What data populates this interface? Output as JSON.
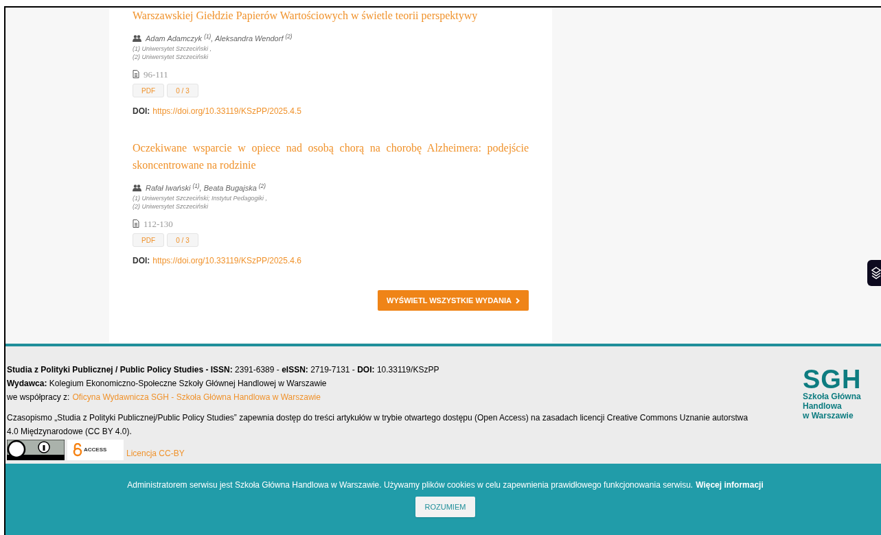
{
  "articles": [
    {
      "title": "Warszawskiej Giełdzie Papierów Wartościowych w świetle teorii perspektywy",
      "authors": "Adam Adamczyk $^{(1)}$, Aleksandra Wendorf $^{(2)}$",
      "affiliations": [
        "(1) Uniwersytet Szczeciński ,",
        "(2) Uniwersytet Szczeciński"
      ],
      "pages": "96-111",
      "buttons": [
        "PDF",
        "0 / 3"
      ],
      "doi_label": "DOI:",
      "doi": "https://doi.org/10.33119/KSzPP/2025.4.5"
    },
    {
      "title": "Oczekiwane wsparcie w opiece nad osobą chorą na chorobę Alzheimera: podejście skoncentrowane na rodzinie",
      "authors": "Rafał Iwański $^{(1)}$, Beata Bugajska $^{(2)}$",
      "affiliations": [
        "(1) Uniwersytet Szczeciński; Instytut Pedagogiki ,",
        "(2) Uniwersytet Szczeciński"
      ],
      "pages": "112-130",
      "buttons": [
        "PDF",
        "0 / 3"
      ],
      "doi_label": "DOI:",
      "doi": "https://doi.org/10.33119/KSzPP/2025.4.6"
    }
  ],
  "all_issues_button": "WYŚWIETL WSZYSTKIE WYDANIA",
  "footer": {
    "journal": "**Studia z Polityki Publicznej / Public Policy Studies - ISSN:** 2391-6389 - **eISSN:** 2719-7131 - **DOI:** 10.33119/KSzPP",
    "publisher": "**Wydawca:** Kolegium Ekonomiczno-Społeczne Szkoły Głównej Handlowej w Warszawie",
    "cooperation_label": "we współpracy z:",
    "cooperation_link": "Oficyna Wydawnicza SGH - Szkoła Główna Handlowa w Warszawie",
    "license_text": "Czasopismo „Studia z Polityki Publicznej/Public Policy Studies” zapewnia dostęp do treści artykułów w trybie otwartego dostępu (Open Access) na zasadach licencji Creative Commons Uznanie autorstwa 4.0 Międzynarodowe (CC BY 4.0).",
    "open_access": "ACCESS",
    "license_link": "Licencja CC-BY",
    "logo": {
      "name": "SGH",
      "line1": "Szkoła Główna",
      "line2": "Handlowa",
      "line3": "w Warszawie"
    }
  },
  "cookie": {
    "text": "Administratorem serwisu jest Szkoła Główna Handlowa w Warszawie. Używamy plików cookies w celu zapewnienia prawidłowego funkcjonowania serwisu.",
    "link": "Więcej informacji",
    "button": "ROZUMIEM"
  }
}
